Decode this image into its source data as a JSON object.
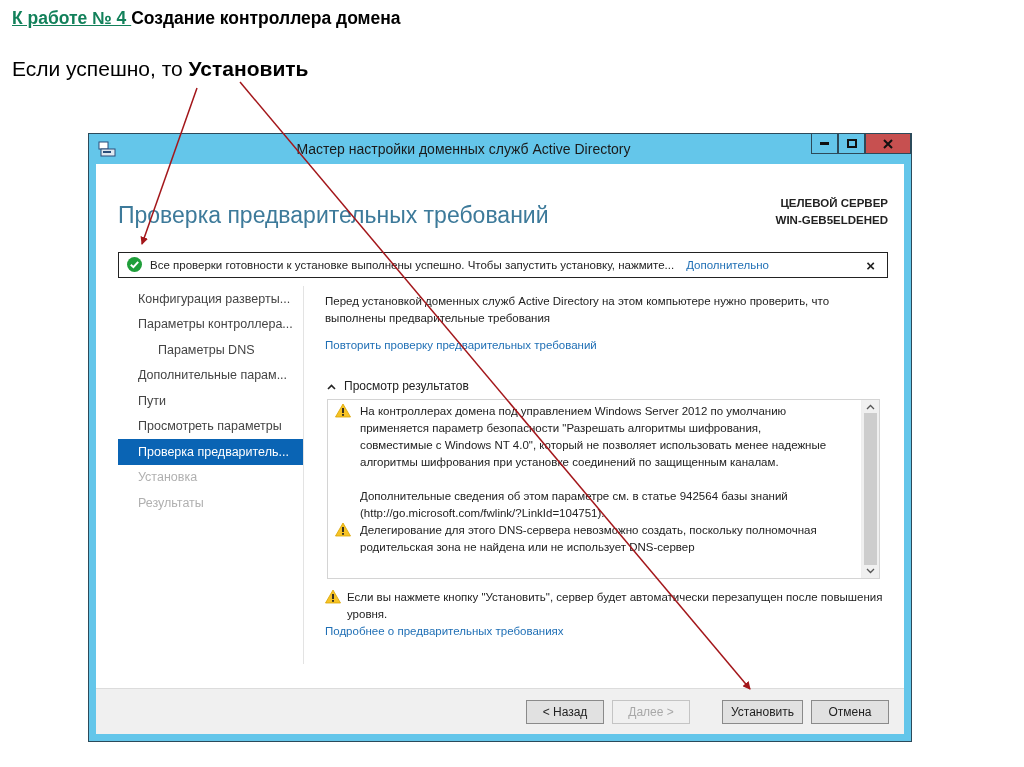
{
  "slide": {
    "title_link": "К работе № 4 ",
    "title": "Создание контроллера домена",
    "subtitle": "Если успешно, то **Установить**"
  },
  "window": {
    "title": "Мастер настройки доменных служб Active Directory",
    "heading": "Проверка предварительных требований",
    "target_label": "ЦЕЛЕВОЙ СЕРВЕР",
    "target_server": "WIN-GEB5ELDEHED"
  },
  "banner": {
    "text": "Все проверки готовности к установке выполнены успешно.  Чтобы запустить установку, нажмите...",
    "link": "Дополнительно",
    "close": "×"
  },
  "nav": [
    {
      "label": "Конфигурация разверты...",
      "selected": false,
      "disabled": false
    },
    {
      "label": "Параметры контроллера...",
      "selected": false,
      "disabled": false,
      "children": [
        {
          "label": "Параметры DNS",
          "selected": false,
          "disabled": false
        }
      ]
    },
    {
      "label": "Дополнительные парам...",
      "selected": false,
      "disabled": false
    },
    {
      "label": "Пути",
      "selected": false,
      "disabled": false
    },
    {
      "label": "Просмотреть параметры",
      "selected": false,
      "disabled": false
    },
    {
      "label": "Проверка предваритель...",
      "selected": true,
      "disabled": false
    },
    {
      "label": "Установка",
      "selected": false,
      "disabled": true
    },
    {
      "label": "Результаты",
      "selected": false,
      "disabled": true
    }
  ],
  "content": {
    "intro": "Перед установкой доменных служб Active Directory на этом компьютере нужно проверить, что выполнены предварительные требования",
    "recheck_link": "Повторить проверку предварительных требований",
    "results": {
      "title": "Просмотр результатов",
      "expanded": true,
      "items": [
        {
          "kind": "warning",
          "paragraphs": [
            "На контроллерах домена под управлением Windows Server 2012 по умолчанию применяется параметр безопасности \"Разрешать алгоритмы шифрования, совместимые с Windows NT 4.0\", который не позволяет использовать менее надежные алгоритмы шифрования при установке соединений по защищенным каналам.",
            "Дополнительные сведения об этом параметре см. в статье 942564 базы знаний (http://go.microsoft.com/fwlink/?LinkId=104751)."
          ]
        },
        {
          "kind": "warning",
          "paragraphs": [
            "Делегирование для этого DNS-сервера невозможно создать, поскольку полномочная родительская зона не найдена или не использует DNS-сервер"
          ]
        }
      ]
    },
    "note": {
      "kind": "warning",
      "text": "Если вы нажмете кнопку \"Установить\", сервер будет автоматически перезапущен после повышения уровня."
    },
    "more_link": "Подробнее о предварительных требованиях"
  },
  "buttons": [
    {
      "label": "< Назад",
      "disabled": false
    },
    {
      "label": "Далее >",
      "disabled": true
    },
    {
      "label": "Установить",
      "disabled": false
    },
    {
      "label": "Отмена",
      "disabled": false
    }
  ]
}
